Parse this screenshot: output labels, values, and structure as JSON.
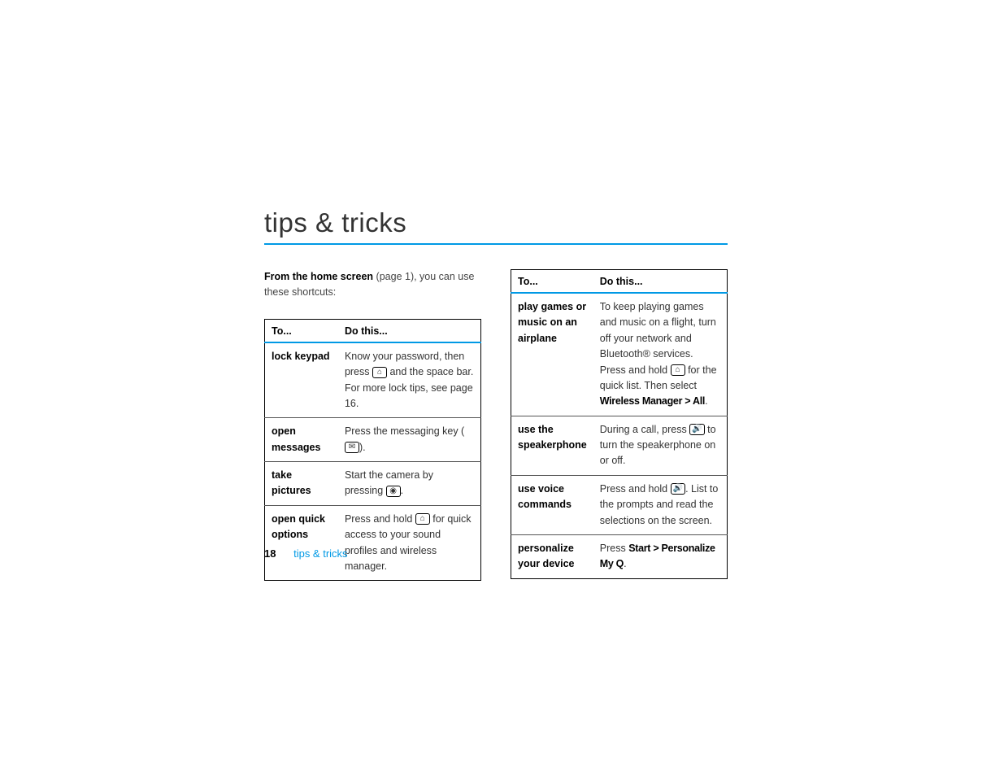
{
  "title": "tips & tricks",
  "intro": {
    "bold": "From the home screen",
    "rest": " (page 1), you can use these shortcuts:"
  },
  "headers": {
    "to": "To...",
    "do": "Do this..."
  },
  "left_rows": [
    {
      "to": "lock keypad",
      "do_pre": "Know your password, then press ",
      "icon": "home",
      "do_post": " and the space bar. For more lock tips, see page 16."
    },
    {
      "to": "open messages",
      "do_pre": "Press the messaging key (",
      "icon": "msg",
      "do_post": ")."
    },
    {
      "to": "take pictures",
      "do_pre": "Start the camera by pressing ",
      "icon": "cam",
      "do_post": "."
    },
    {
      "to": "open quick options",
      "do_pre": "Press and hold ",
      "icon": "home",
      "do_post": " for quick access to your sound profiles and wireless manager."
    }
  ],
  "right_rows": [
    {
      "to": "play games or music on an airplane",
      "do_pre": "To keep playing games and music on a flight, turn off your network and Bluetooth® services. Press and hold ",
      "icon": "home",
      "do_post": " for the quick list. Then select ",
      "menu": "Wireless Manager > All",
      "tail": "."
    },
    {
      "to": "use the speakerphone",
      "do_pre": "During a call, press ",
      "icon": "spk",
      "do_post": " to turn the speakerphone on or off."
    },
    {
      "to": "use voice commands",
      "do_pre": "Press and hold ",
      "icon": "spk",
      "do_post": ". List to the prompts and read the selections on the screen."
    },
    {
      "to": "personalize your device",
      "do_pre": "Press ",
      "menu": "Start > Personalize My Q",
      "tail": "."
    }
  ],
  "footer": {
    "page": "18",
    "section": "tips & tricks"
  },
  "icons": {
    "home": "⌂",
    "msg": "✉",
    "cam": "◉",
    "spk": "🔊"
  }
}
